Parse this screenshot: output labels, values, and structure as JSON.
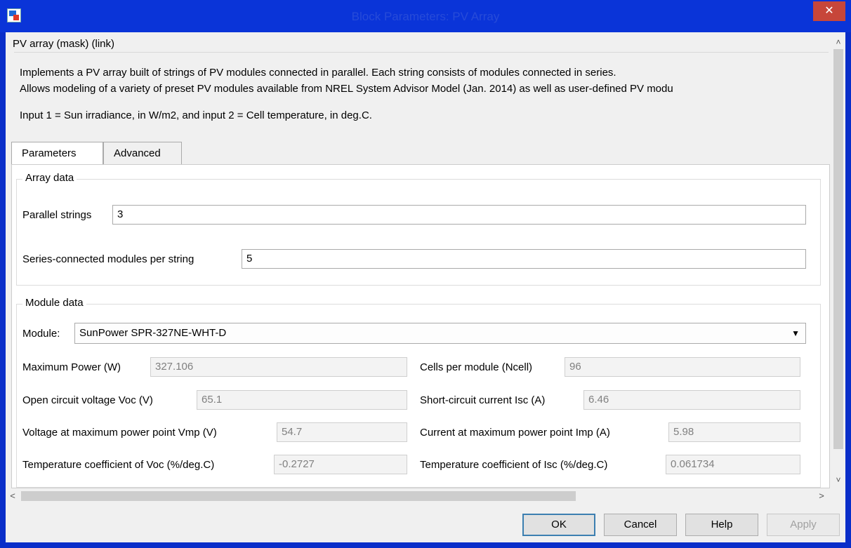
{
  "window": {
    "title": "Block Parameters: PV Array",
    "close_glyph": "✕"
  },
  "mask": {
    "title": "PV array (mask) (link)",
    "desc_line1": "Implements a PV array built of strings of PV modules connected in parallel. Each string consists of modules connected in series.",
    "desc_line2": "Allows modeling of a variety of preset PV modules available from NREL System Advisor Model (Jan. 2014) as well as user-defined PV modu",
    "desc_input": "Input 1 = Sun irradiance, in W/m2, and input 2 = Cell temperature, in deg.C."
  },
  "tabs": [
    {
      "label": "Parameters",
      "active": true
    },
    {
      "label": "Advanced",
      "active": false
    }
  ],
  "array_data": {
    "group_label": "Array data",
    "parallel_strings_label": "Parallel strings",
    "parallel_strings_value": "3",
    "series_modules_label": "Series-connected modules per string",
    "series_modules_value": "5"
  },
  "module_data": {
    "group_label": "Module data",
    "module_label": "Module:",
    "module_value": "SunPower SPR-327NE-WHT-D",
    "max_power_label": "Maximum Power (W)",
    "max_power_value": "327.106",
    "cells_label": "Cells per module (Ncell)",
    "cells_value": "96",
    "voc_label": "Open circuit voltage  Voc (V)",
    "voc_value": "65.1",
    "isc_label": "Short-circuit current Isc (A)",
    "isc_value": "6.46",
    "vmp_label": "Voltage at maximum power point Vmp (V)",
    "vmp_value": "54.7",
    "imp_label": "Current at maximum power point Imp (A)",
    "imp_value": "5.98",
    "tc_voc_label": "Temperature coefficient of Voc (%/deg.C)",
    "tc_voc_value": "-0.2727",
    "tc_isc_label": "Temperature coefficient of Isc (%/deg.C)",
    "tc_isc_value": "0.061734"
  },
  "buttons": {
    "ok": "OK",
    "cancel": "Cancel",
    "help": "Help",
    "apply": "Apply"
  },
  "colors": {
    "titlebar": "#0a34d8",
    "close": "#c7463a",
    "default_button_border": "#3c7fb1"
  }
}
